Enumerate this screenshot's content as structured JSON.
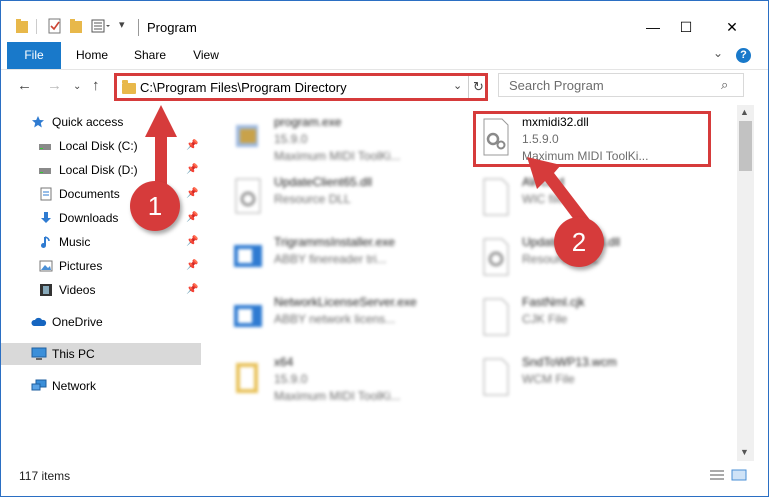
{
  "window": {
    "title": "Program",
    "controls": {
      "minimize": "—",
      "maximize": "☐",
      "close": "✕"
    }
  },
  "ribbon": {
    "tabs": [
      {
        "label": "File",
        "active": true
      },
      {
        "label": "Home",
        "active": false
      },
      {
        "label": "Share",
        "active": false
      },
      {
        "label": "View",
        "active": false
      }
    ],
    "help": "?"
  },
  "navbar": {
    "address": "C:\\Program Files\\Program Directory",
    "search_placeholder": "Search Program"
  },
  "sidebar": {
    "items": [
      {
        "label": "Quick access",
        "icon": "star-icon",
        "pinned": false
      },
      {
        "label": "Local Disk (C:)",
        "icon": "drive-icon",
        "pinned": true
      },
      {
        "label": "Local Disk (D:)",
        "icon": "drive-icon",
        "pinned": true
      },
      {
        "label": "Documents",
        "icon": "documents-icon",
        "pinned": true
      },
      {
        "label": "Downloads",
        "icon": "download-icon",
        "pinned": true
      },
      {
        "label": "Music",
        "icon": "music-icon",
        "pinned": true
      },
      {
        "label": "Pictures",
        "icon": "pictures-icon",
        "pinned": true
      },
      {
        "label": "Videos",
        "icon": "videos-icon",
        "pinned": true
      },
      {
        "label": "OneDrive",
        "icon": "cloud-icon",
        "pinned": false
      },
      {
        "label": "This PC",
        "icon": "computer-icon",
        "pinned": false,
        "selected": true
      },
      {
        "label": "Network",
        "icon": "network-icon",
        "pinned": false
      }
    ]
  },
  "files": {
    "left": [
      {
        "name": "program.exe",
        "line2": "15.9.0",
        "line3": "Maximum MIDI ToolKi..."
      },
      {
        "name": "UpdateClient65.dll",
        "line2": "Resource DLL",
        "line3": ""
      },
      {
        "name": "TrigrammsInstaller.exe",
        "line2": "ABBY finereader tri...",
        "line3": ""
      },
      {
        "name": "NetworkLicenseServer.exe",
        "line2": "ABBY network licens...",
        "line3": ""
      },
      {
        "name": "x64",
        "line2": "15.9.0",
        "line3": "Maximum MIDI ToolKi..."
      }
    ],
    "right": [
      {
        "name": "mxmidi32.dll",
        "line2": "1.5.9.0",
        "line3": "Maximum MIDI ToolKi...",
        "highlighted": true
      },
      {
        "name": "AWcard",
        "line2": "WIC file",
        "line3": ""
      },
      {
        "name": "UpdateClient63.dll",
        "line2": "Resource DLL",
        "line3": ""
      },
      {
        "name": "FastNml.cjk",
        "line2": "CJK File",
        "line3": ""
      },
      {
        "name": "SndToWP13.wcm",
        "line2": "WCM File",
        "line3": ""
      }
    ]
  },
  "status": {
    "items": "117 items"
  },
  "annotations": {
    "badge1": "1",
    "badge2": "2",
    "color": "#d63b3b"
  },
  "colors": {
    "accent": "#1979ca",
    "highlight": "#d63b3b"
  }
}
